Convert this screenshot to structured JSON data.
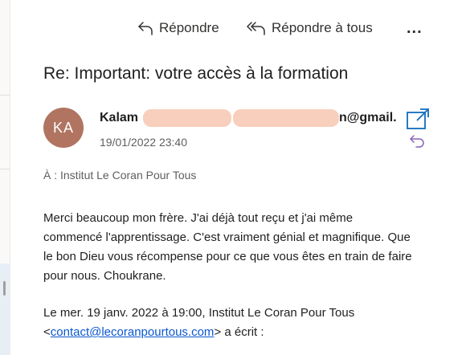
{
  "toolbar": {
    "reply_label": "Répondre",
    "reply_all_label": "Répondre à tous",
    "more_label": "..."
  },
  "message": {
    "subject": "Re: Important: votre accès à la formation",
    "avatar_initials": "KA",
    "avatar_color": "#b07461",
    "sender_visible_start": "Kalam",
    "sender_visible_end": "n@gmail.",
    "date": "19/01/2022 23:40",
    "to_line": "À : Institut Le Coran Pour Tous",
    "body_line1": "Merci beaucoup mon frère. J'ai déjà tout reçu et j'ai même",
    "body_line2": "commencé l'apprentissage. C'est vraiment génial et magnifique. Que",
    "body_line3": "le bon Dieu vous récompense pour ce que vous êtes en train de faire",
    "body_line4": "pour nous. Choukrane.",
    "quote_line1": "Le mer. 19 janv. 2022 à 19:00, Institut Le Coran Pour Tous",
    "quote_open": "<",
    "quote_email": "contact@lecoranpourtous.com",
    "quote_close": "> a écrit :"
  },
  "colors": {
    "accent": "#0f6cbd",
    "reply_icon": "#8764b8",
    "redaction": "#f7c7b0"
  }
}
